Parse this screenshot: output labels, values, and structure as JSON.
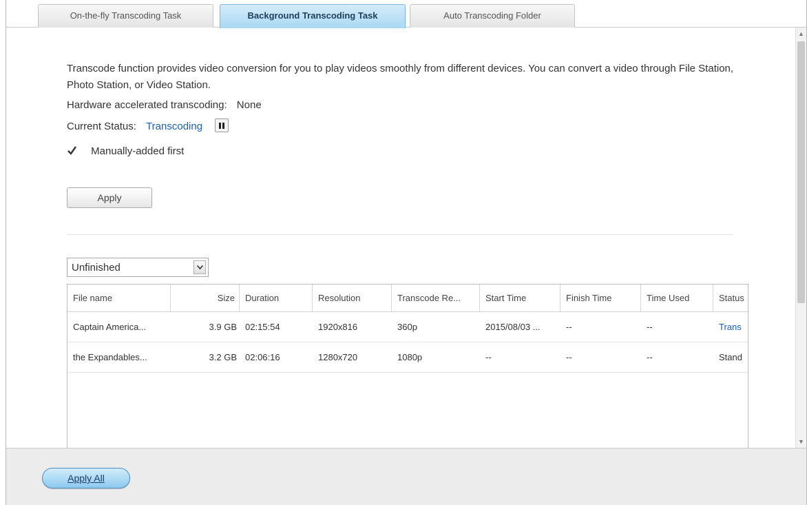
{
  "tabs": [
    {
      "label": "On-the-fly Transcoding Task",
      "active": false
    },
    {
      "label": "Background Transcoding Task",
      "active": true
    },
    {
      "label": "Auto Transcoding Folder",
      "active": false
    }
  ],
  "description": "Transcode function provides video conversion for you to play videos smoothly from different devices. You can convert a video through File Station, Photo Station, or Video Station.",
  "hardware": {
    "label": "Hardware accelerated transcoding:",
    "value": "None"
  },
  "status": {
    "label": "Current Status:",
    "value": "Transcoding"
  },
  "manual_first": {
    "label": "Manually-added first",
    "checked": true
  },
  "apply_label": "Apply",
  "filter": {
    "selected": "Unfinished"
  },
  "table": {
    "headers": [
      "File name",
      "Size",
      "Duration",
      "Resolution",
      "Transcode Re...",
      "Start Time",
      "Finish Time",
      "Time Used",
      "Status"
    ],
    "rows": [
      {
        "file": "Captain America...",
        "size": "3.9 GB",
        "duration": "02:15:54",
        "resolution": "1920x816",
        "transcode": "360p",
        "start": "2015/08/03 ...",
        "finish": "--",
        "used": "--",
        "status": "Trans"
      },
      {
        "file": "the Expandables...",
        "size": "3.2 GB",
        "duration": "02:06:16",
        "resolution": "1280x720",
        "transcode": "1080p",
        "start": "--",
        "finish": "--",
        "used": "--",
        "status": "Stand"
      }
    ]
  },
  "apply_all_label": "Apply All",
  "colors": {
    "link": "#1f5fb2",
    "active_tab": "#a9d8f3",
    "footer": "#ececec"
  }
}
